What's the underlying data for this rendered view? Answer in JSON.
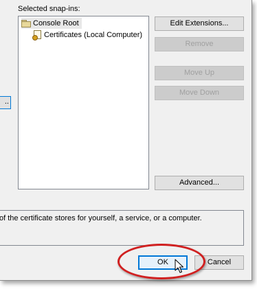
{
  "dialog": {
    "selected_label": "Selected snap-ins:",
    "tree": [
      {
        "label": "Console Root",
        "icon": "folder-icon"
      },
      {
        "label": "Certificates (Local Computer)",
        "icon": "certificate-icon"
      }
    ],
    "buttons": {
      "edit_extensions": "Edit Extensions...",
      "remove": "Remove",
      "move_up": "Move Up",
      "move_down": "Move Down",
      "advanced": "Advanced...",
      "side": "..",
      "ok": "OK",
      "cancel": "Cancel"
    },
    "description": "of the certificate stores for yourself, a service, or a computer."
  },
  "annotation": {
    "highlight_color": "#d02020",
    "accent": "#0078d7"
  }
}
